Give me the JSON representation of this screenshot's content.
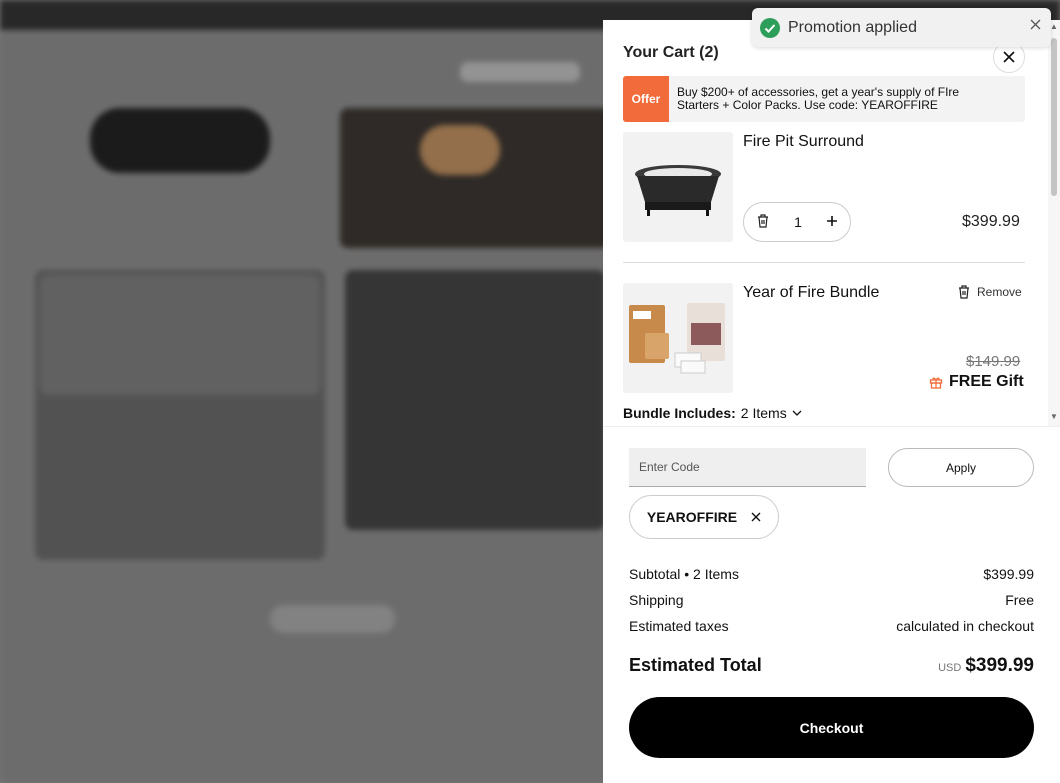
{
  "cart": {
    "title": "Your Cart (2)",
    "offer": {
      "badge": "Offer",
      "text": "Buy $200+ of accessories, get a year's supply of FIre Starters + Color Packs. Use code: YEAROFFIRE"
    },
    "items": [
      {
        "name": "Fire Pit Surround",
        "quantity": "1",
        "price": "$399.99"
      },
      {
        "name": "Year of Fire Bundle",
        "remove_label": "Remove",
        "original_price": "$149.99",
        "gift_label": "FREE Gift",
        "bundle_label": "Bundle Includes:",
        "bundle_count": "2 Items"
      }
    ]
  },
  "promo": {
    "placeholder": "Enter Code",
    "apply_label": "Apply",
    "applied_code": "YEAROFFIRE"
  },
  "summary": {
    "subtotal_label": "Subtotal • 2 Items",
    "subtotal_value": "$399.99",
    "shipping_label": "Shipping",
    "shipping_value": "Free",
    "taxes_label": "Estimated taxes",
    "taxes_value": "calculated in checkout",
    "total_label": "Estimated Total",
    "currency": "USD",
    "total_value": "$399.99"
  },
  "checkout_label": "Checkout",
  "toast": {
    "message": "Promotion applied"
  },
  "colors": {
    "accent": "#f26b3a",
    "success": "#2e9e5b"
  }
}
